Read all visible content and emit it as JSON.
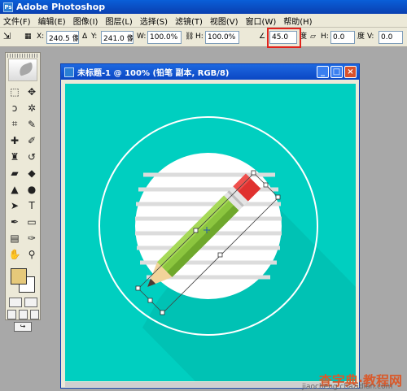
{
  "app": {
    "title": "Adobe Photoshop"
  },
  "menu": {
    "items": [
      "文件(F)",
      "编辑(E)",
      "图像(I)",
      "图层(L)",
      "选择(S)",
      "滤镜(T)",
      "视图(V)",
      "窗口(W)",
      "帮助(H)"
    ]
  },
  "options": {
    "x_label": "X:",
    "x_value": "240.5 像",
    "y_label": "Y:",
    "y_value": "241.0 像",
    "w_label": "W:",
    "w_value": "100.0%",
    "h_label": "H:",
    "h_value": "100.0%",
    "angle_value": "45.0",
    "angle_unit": "度",
    "hskew_label": "H:",
    "hskew_value": "0.0",
    "hskew_unit": "度",
    "vskew_label": "V:",
    "vskew_value": "0.0"
  },
  "document": {
    "title": "未标题-1 @ 100% (铅笔 副本, RGB/8)",
    "min_btn": "_",
    "max_btn": "□",
    "close_btn": "×"
  },
  "canvas": {
    "bg_color": "#00cfc0",
    "ring_color": "#ffffff",
    "pencil_body_color": "#8cc63f",
    "pencil_eraser_color": "#e0312f"
  },
  "tools": {
    "fg_color": "#e6c97a",
    "bg_color": "#ffffff"
  },
  "watermark": {
    "text": "查字典·教程网",
    "site": "jiaocheng.chazidian.com"
  }
}
